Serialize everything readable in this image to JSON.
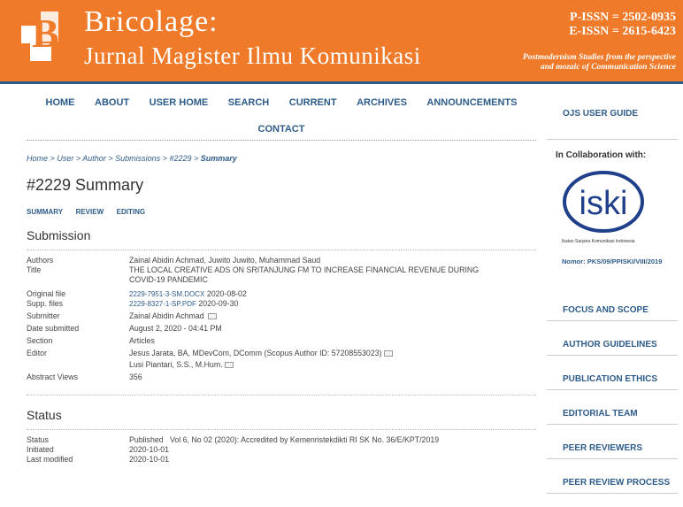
{
  "header": {
    "title": "Bricolage:",
    "subtitle": "Jurnal Magister Ilmu Komunikasi",
    "logo_letter": "B",
    "pissn": "P-ISSN = 2502-0935",
    "eissn": "E-ISSN = 2615-6423",
    "tagline_1": "Postmodernism Studies from the perspective",
    "tagline_2": "and mozaic of Communication Science"
  },
  "nav": {
    "home": "HOME",
    "about": "ABOUT",
    "user_home": "USER HOME",
    "search": "SEARCH",
    "current": "CURRENT",
    "archives": "ARCHIVES",
    "announcements": "ANNOUNCEMENTS",
    "contact": "CONTACT"
  },
  "breadcrumb": {
    "home": "Home",
    "user": "User",
    "author": "Author",
    "submissions": "Submissions",
    "id": "#2229",
    "summary": "Summary",
    "sep": ">"
  },
  "page_title": "#2229 Summary",
  "tabs": {
    "summary": "SUMMARY",
    "review": "REVIEW",
    "editing": "EDITING"
  },
  "submission": {
    "heading": "Submission",
    "authors_label": "Authors",
    "authors": "Zainal Abidin Achmad, Juwito Juwito, Muhammad Saud",
    "title_label": "Title",
    "title_1": "THE LOCAL CREATIVE ADS ON SRITANJUNG FM TO INCREASE FINANCIAL REVENUE DURING",
    "title_2": "COVID-19 PANDEMIC",
    "original_label": "Original file",
    "original_file": "2229-7951-3-SM.DOCX",
    "original_date": "2020-08-02",
    "supp_label": "Supp. files",
    "supp_file": "2229-8327-1-SP.PDF",
    "supp_date": "2020-09-30",
    "submitter_label": "Submitter",
    "submitter": "Zainal Abidin Achmad",
    "date_label": "Date submitted",
    "date": "August 2, 2020 - 04:41 PM",
    "section_label": "Section",
    "section": "Articles",
    "editor_label": "Editor",
    "editor_1": "Jesus Jarata, BA, MDevCom, DComm (Scopus Author ID: 57208553023)",
    "editor_2": "Lusi Piantari, S.S., M.Hum.",
    "views_label": "Abstract Views",
    "views": "356"
  },
  "status": {
    "heading": "Status",
    "status_label": "Status",
    "status": "Published",
    "status_detail": "Vol 6, No 02 (2020): Accredited by Kemenristekdikti RI SK No. 36/E/KPT/2019",
    "initiated_label": "Initiated",
    "initiated": "2020-10-01",
    "modified_label": "Last modified",
    "modified": "2020-10-01"
  },
  "sidebar": {
    "ojs_guide": "OJS USER GUIDE",
    "collab": "In Collaboration with:",
    "iski_text": "iski",
    "iski_caption": "Ikatan Sarjana Komunikasi Indonesia",
    "iski_no": "Nomor: PKS/09/PPISKI/VIII/2019",
    "links": [
      "FOCUS AND SCOPE",
      "AUTHOR GUIDELINES",
      "PUBLICATION ETHICS",
      "EDITORIAL TEAM",
      "PEER REVIEWERS",
      "PEER REVIEW PROCESS"
    ]
  },
  "colors": {
    "banner": "#ee7a2a",
    "link": "#2e5c8a"
  }
}
